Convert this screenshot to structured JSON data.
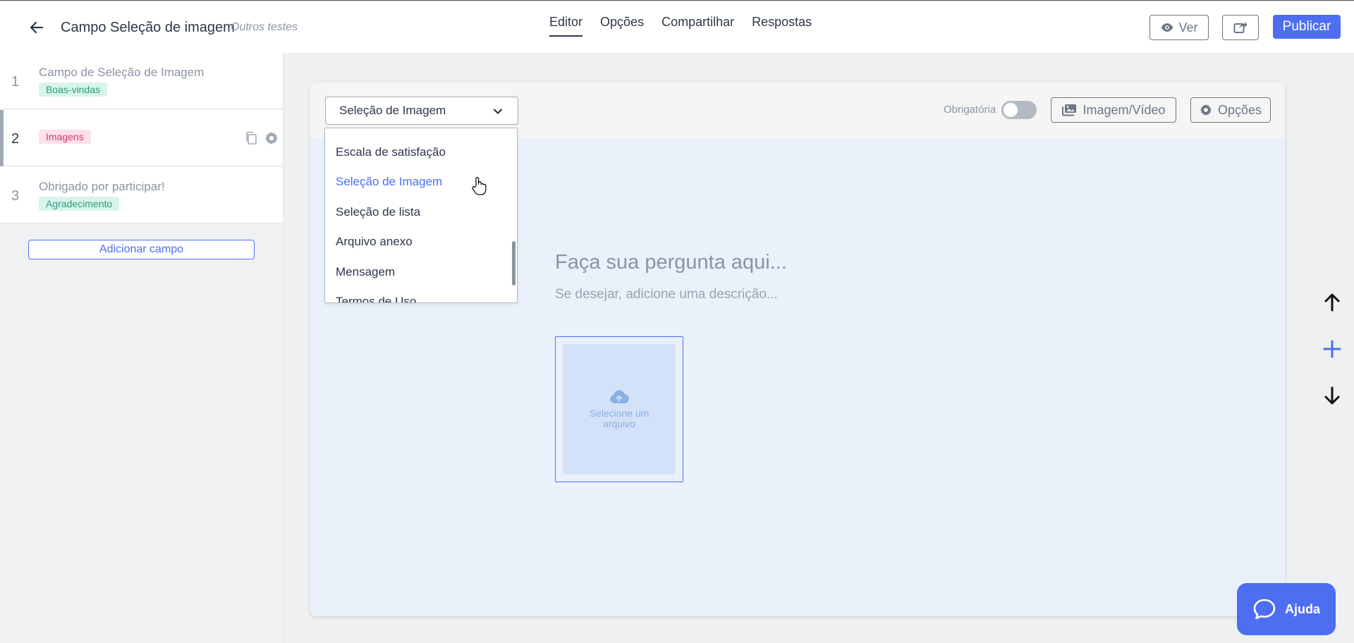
{
  "header": {
    "title": "Campo Seleção de imagem",
    "folder": "Outros testes",
    "tabs": [
      {
        "label": "Editor"
      },
      {
        "label": "Opções"
      },
      {
        "label": "Compartilhar"
      },
      {
        "label": "Respostas"
      }
    ],
    "view_label": "Ver",
    "publish_label": "Publicar"
  },
  "sidebar": {
    "fields": [
      {
        "number": "1",
        "label": "Campo de Seleção de Imagem",
        "badge": "Boas-vindas"
      },
      {
        "number": "2",
        "label": "",
        "badge": "Imagens"
      },
      {
        "number": "3",
        "label": "Obrigado por participar!",
        "badge": "Agradecimento"
      }
    ],
    "add_field_label": "Adicionar campo"
  },
  "editor": {
    "field_type": "Seleção de Imagem",
    "required_label": "Obrigatória",
    "media_label": "Imagem/Vídeo",
    "options_label": "Opções",
    "question_placeholder": "Faça sua pergunta aqui...",
    "description_placeholder": "Se desejar, adicione uma descrição...",
    "upload_label": "Selecione um arquivo"
  },
  "dropdown": {
    "options": [
      "Escala de satisfação",
      "Seleção de Imagem",
      "Seleção de lista",
      "Arquivo anexo",
      "Mensagem",
      "Termos de Uso"
    ],
    "selected": "Seleção de Imagem"
  },
  "help": {
    "label": "Ajuda"
  },
  "colors": {
    "accent": "#4e6ef2",
    "badge_green_bg": "#d9f4ec",
    "badge_green_text": "#2a9d7c",
    "badge_pink_bg": "#fde0ea",
    "badge_pink_text": "#d63869"
  },
  "icons": {
    "back": "arrow-left-icon",
    "view": "eye-icon",
    "share": "share-icon",
    "copy": "copy-icon",
    "settings": "gear-icon",
    "chevron": "chevron-down-icon",
    "media": "images-icon",
    "upload": "cloud-upload-icon",
    "up": "arrow-up-icon",
    "add": "plus-icon",
    "down": "arrow-down-icon",
    "help": "chat-bubble-icon"
  }
}
